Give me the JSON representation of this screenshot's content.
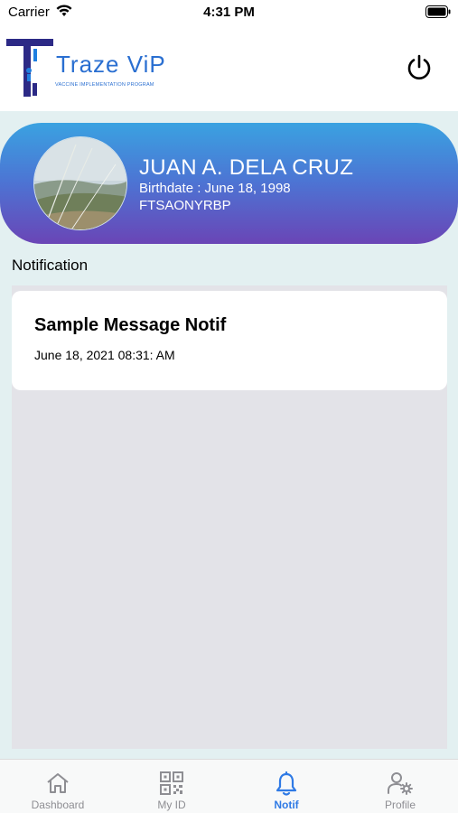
{
  "status_bar": {
    "carrier": "Carrier",
    "time": "4:31 PM"
  },
  "header": {
    "logo_name": "Traze ViP",
    "logo_tagline": "VACCINE IMPLEMENTATION PROGRAM",
    "logo_letters": "TViP",
    "power_icon": "power-icon"
  },
  "profile": {
    "name": "JUAN A. DELA CRUZ",
    "birthdate": "Birthdate : June 18, 1998",
    "code": "FTSAONYRBP"
  },
  "notifications": {
    "section_title": "Notification",
    "items": [
      {
        "title": "Sample Message Notif",
        "date": "June 18, 2021 08:31: AM"
      }
    ]
  },
  "tabs": [
    {
      "label": "Dashboard",
      "icon": "home-icon",
      "active": false
    },
    {
      "label": "My ID",
      "icon": "qr-code-icon",
      "active": false
    },
    {
      "label": "Notif",
      "icon": "bell-icon",
      "active": true
    },
    {
      "label": "Profile",
      "icon": "user-settings-icon",
      "active": false
    }
  ],
  "colors": {
    "accent": "#2f7ae5",
    "card_gradient_top": "#3aa2e1",
    "card_gradient_bottom": "#6a45b6",
    "background": "#e3f0f1"
  }
}
